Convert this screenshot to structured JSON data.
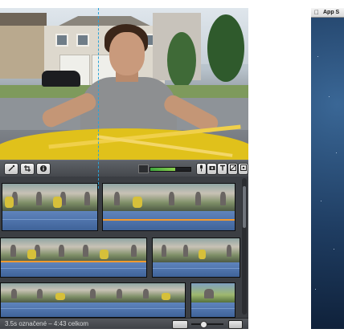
{
  "imovie": {
    "status_text": "3.5s označené – 4:43 celkom",
    "audio_level": 0.62,
    "zoom_level": 0.35
  },
  "mac_window": {
    "menu_title": "App S"
  },
  "icons": {
    "toolbar_left": [
      "wand-icon",
      "crop-icon",
      "info-icon"
    ],
    "toolbar_right": [
      "microphone-icon",
      "camera-icon",
      "title-icon",
      "transition-icon",
      "map-icon"
    ],
    "status": [
      "view-toggle-icon",
      "zoom-slider-icon"
    ]
  },
  "colors": {
    "selection": "#f29a2e",
    "playhead": "#2aa3d8",
    "waveform": "#4a6fa6"
  }
}
